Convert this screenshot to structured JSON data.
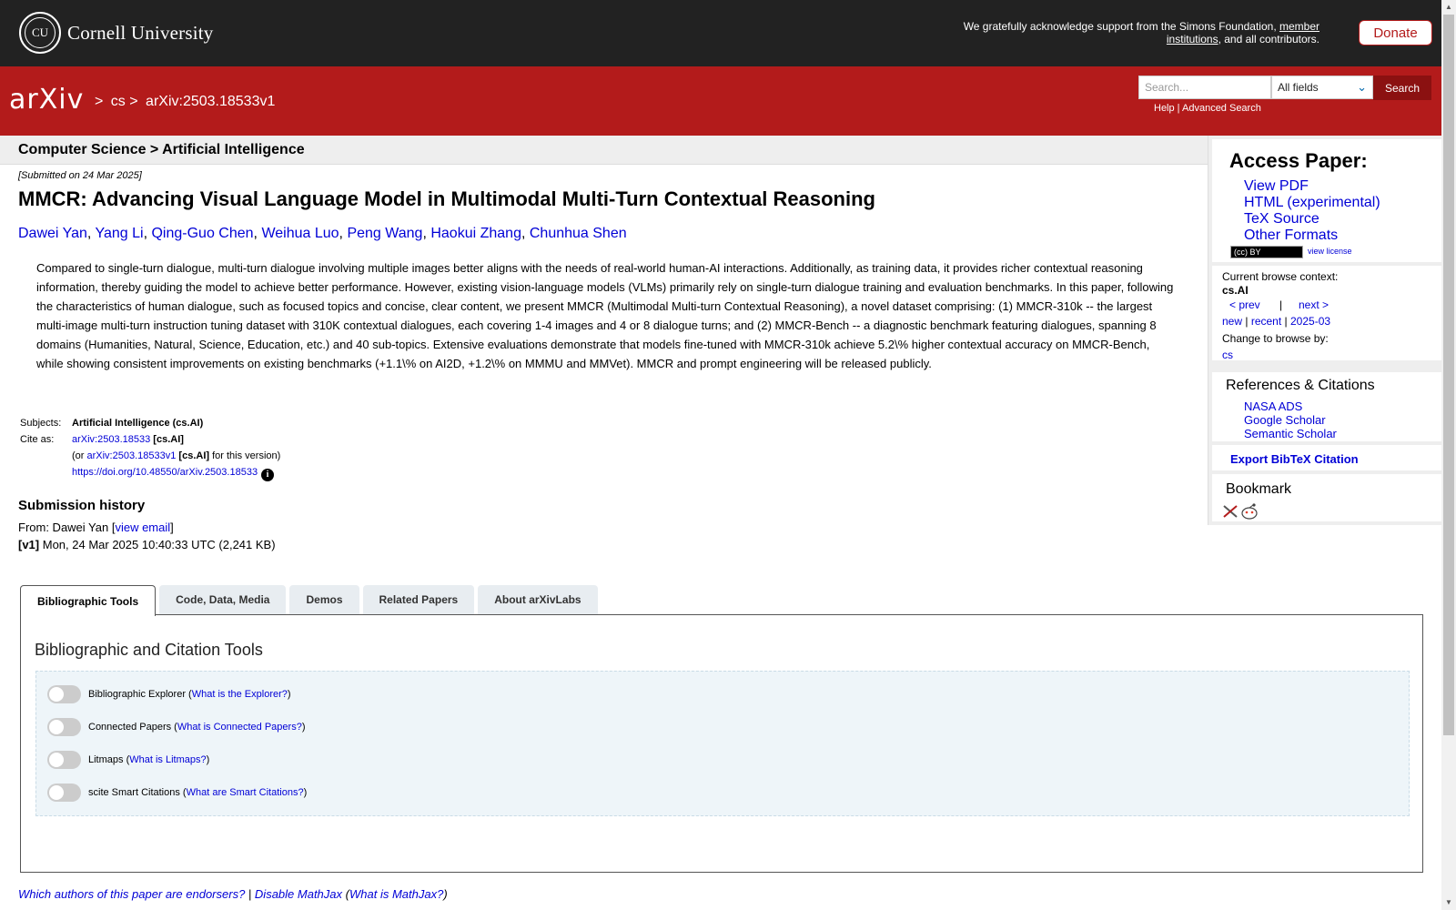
{
  "cornell": {
    "name": "Cornell University",
    "seal_text": "CU",
    "support_pre": "We gratefully acknowledge support from the Simons Foundation, ",
    "support_link": "member institutions",
    "support_post": ", and all contributors.",
    "donate": "Donate"
  },
  "header": {
    "logo": "arXiv",
    "crumb_sep": ">",
    "crumb_cs": "cs",
    "crumb_id": "arXiv:2503.18533v1",
    "search_placeholder": "Search...",
    "field_select": "All fields",
    "search_button": "Search",
    "help": "Help",
    "sep": " | ",
    "advanced": "Advanced Search"
  },
  "subject_bar": "Computer Science > Artificial Intelligence",
  "paper": {
    "submitted": "[Submitted on 24 Mar 2025]",
    "title": "MMCR: Advancing Visual Language Model in Multimodal Multi-Turn Contextual Reasoning",
    "authors": [
      "Dawei Yan",
      "Yang Li",
      "Qing-Guo Chen",
      "Weihua Luo",
      "Peng Wang",
      "Haokui Zhang",
      "Chunhua Shen"
    ],
    "abstract": "Compared to single-turn dialogue, multi-turn dialogue involving multiple images better aligns with the needs of real-world human-AI interactions. Additionally, as training data, it provides richer contextual reasoning information, thereby guiding the model to achieve better performance. However, existing vision-language models (VLMs) primarily rely on single-turn dialogue training and evaluation benchmarks. In this paper, following the characteristics of human dialogue, such as focused topics and concise, clear content, we present MMCR (Multimodal Multi-turn Contextual Reasoning), a novel dataset comprising: (1) MMCR-310k -- the largest multi-image multi-turn instruction tuning dataset with 310K contextual dialogues, each covering 1-4 images and 4 or 8 dialogue turns; and (2) MMCR-Bench -- a diagnostic benchmark featuring dialogues, spanning 8 domains (Humanities, Natural, Science, Education, etc.) and 40 sub-topics. Extensive evaluations demonstrate that models fine-tuned with MMCR-310k achieve 5.2\\% higher contextual accuracy on MMCR-Bench, while showing consistent improvements on existing benchmarks (+1.1\\% on AI2D, +1.2\\% on MMMU and MMVet). MMCR and prompt engineering will be released publicly.",
    "subjects_label": "Subjects:",
    "subjects_value": "Artificial Intelligence (cs.AI)",
    "cite_label": "Cite as:",
    "cite_id": "arXiv:2503.18533",
    "cite_cat": "[cs.AI]",
    "cite_or": "(or ",
    "cite_version_id": "arXiv:2503.18533v1",
    "cite_version_cat": "[cs.AI]",
    "cite_version_tail": " for this version)",
    "doi": "https://doi.org/10.48550/arXiv.2503.18533",
    "info_icon": "i"
  },
  "history": {
    "title": "Submission history",
    "from_pre": "From: Dawei Yan [",
    "view_email": "view email",
    "from_post": "]",
    "v1_label": "[v1]",
    "v1_text": " Mon, 24 Mar 2025 10:40:33 UTC (2,241 KB)"
  },
  "tabs": [
    "Bibliographic Tools",
    "Code, Data, Media",
    "Demos",
    "Related Papers",
    "About arXivLabs"
  ],
  "tools": {
    "title": "Bibliographic and Citation Tools",
    "items": [
      {
        "label": "Bibliographic Explorer (",
        "link": "What is the Explorer?",
        "end": ")"
      },
      {
        "label": "Connected Papers (",
        "link": "What is Connected Papers?",
        "end": ")"
      },
      {
        "label": "Litmaps (",
        "link": "What is Litmaps?",
        "end": ")"
      },
      {
        "label": "scite Smart Citations (",
        "link": "What are Smart Citations?",
        "end": ")"
      }
    ]
  },
  "footer": {
    "endorsers": "Which authors of this paper are endorsers?",
    "sep": " | ",
    "disable_mathjax": "Disable MathJax",
    "what_mathjax_pre": " (",
    "what_mathjax": "What is MathJax?",
    "what_mathjax_post": ")"
  },
  "sidebar": {
    "access_title": "Access Paper:",
    "access_links": [
      "View PDF",
      "HTML (experimental)",
      "TeX Source",
      "Other Formats"
    ],
    "cc_badge": "(cc) BY",
    "view_license": "view license",
    "browse_context_label": "Current browse context:",
    "browse_context": "cs.AI",
    "prev": "< prev",
    "pipe": "|",
    "next": "next >",
    "new": "new",
    "recent": "recent",
    "month": "2025-03",
    "change_browse": "Change to browse by:",
    "browse_cs": "cs",
    "refs_title": "References & Citations",
    "refs_links": [
      "NASA ADS",
      "Google Scholar",
      "Semantic Scholar"
    ],
    "bibtex": "Export BibTeX Citation",
    "bookmark_title": "Bookmark"
  }
}
